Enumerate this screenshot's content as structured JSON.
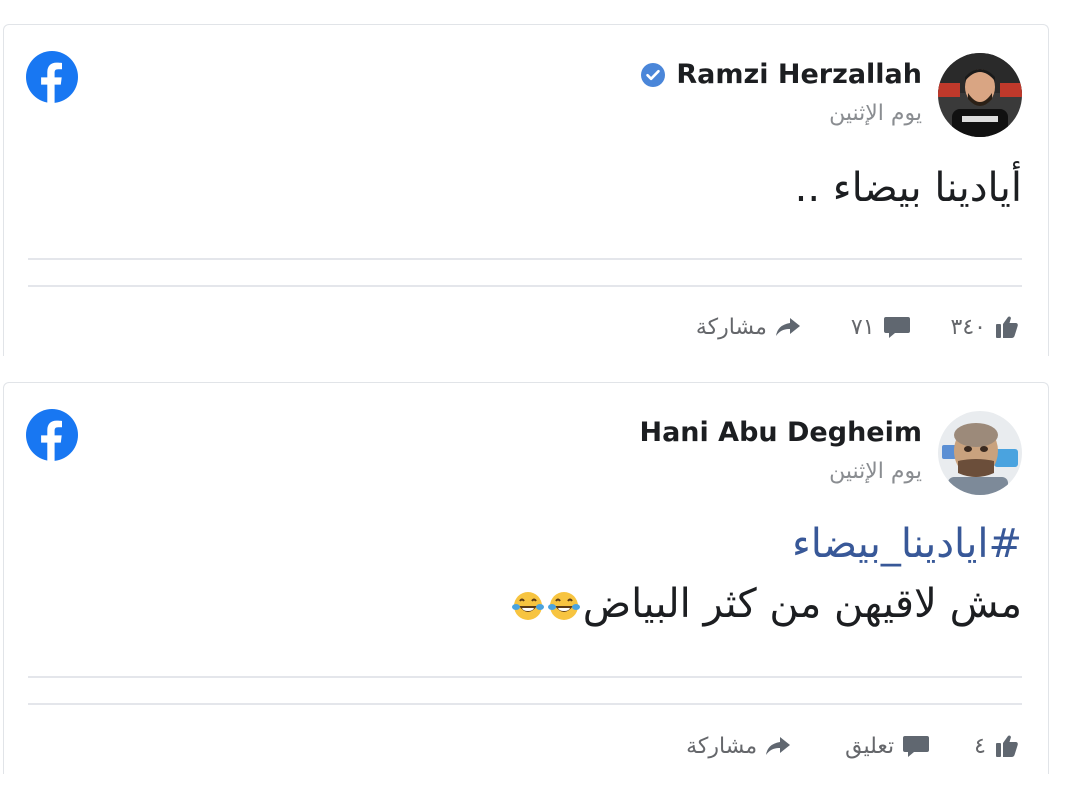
{
  "colors": {
    "facebook_blue": "#1877f2",
    "text_primary": "#1c1e21",
    "text_secondary": "#8a8d91",
    "hashtag": "#385898",
    "icon_gray": "#606770",
    "divider": "#e4e6eb"
  },
  "posts": [
    {
      "author": "Ramzi Herzallah",
      "verified": true,
      "date": "يوم الإثنين",
      "text": "أيادينا بيضاء ..",
      "reactions": {
        "likes": "٣٤٠",
        "comments": "٧١",
        "share_label": "مشاركة"
      },
      "icons": [
        "facebook-logo",
        "verified-badge",
        "avatar-photo",
        "like-icon",
        "comment-icon",
        "share-icon"
      ]
    },
    {
      "author": "Hani Abu Degheim",
      "verified": false,
      "date": "يوم الإثنين",
      "hashtag": "#ايادينا_بيضاء",
      "text": "مش لاقيهن من كثر البياض",
      "emoji": [
        "face-with-tears-of-joy",
        "face-with-tears-of-joy"
      ],
      "reactions": {
        "likes": "٤",
        "comments_label": "تعليق",
        "share_label": "مشاركة"
      },
      "icons": [
        "facebook-logo",
        "avatar-photo",
        "like-icon",
        "comment-icon",
        "share-icon"
      ]
    }
  ]
}
